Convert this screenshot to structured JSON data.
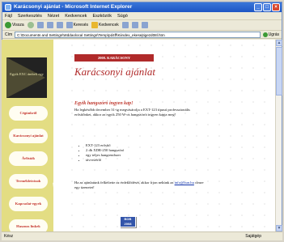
{
  "window": {
    "title": "Karácsonyi ajánlat - Microsoft Internet Explorer",
    "minimize": "_",
    "maximize": "□",
    "close": "×"
  },
  "menu": [
    "Fájl",
    "Szerkesztés",
    "Nézet",
    "Kedvencek",
    "Eszközök",
    "Súgó"
  ],
  "toolbar": {
    "back": "Vissza",
    "search": "Keresés",
    "favorites": "Kedvencek"
  },
  "address": {
    "label": "Cím",
    "value": "C:\\Documents and Settings\\Wddaolocal Settings\\Temp\\pd4ff\\Kiindex_ekesejtigezd08l.htm",
    "go": "Ugrás"
  },
  "status": {
    "left": "Kész",
    "zone": "Sajátgép"
  },
  "page": {
    "logo_text": "Egyik EXC ámbeli egy",
    "nav": [
      "Cégünkről",
      "Karácsonyi ajánlat",
      "Árlisták",
      "Termékleírások",
      "Kapcsolat-egyek",
      "Hasznos linkek"
    ],
    "redbar": "2008. KARÁCSONY",
    "headline": "Karácsonyi ajánlat",
    "subhead": "Egyik hangszóró ingyen kap!",
    "paragraph": "Ha legkésőbb december 31-ig megvásárolja a EXT-123 típusú professzionális erősítőnket, akkor az egyik 250 W-os hangszórót ingyen kapja meg!",
    "list": [
      "EXT-123 erősítő",
      "2 db XDR-250 hangszóró",
      "egy teljes hangrendszer",
      "távvezérlő"
    ],
    "contact_pre": "Ha az ajánlatunk felkeltette az érdeklődését, akkor írjon nekünk az",
    "contact_link": "info@hun.hu",
    "contact_post": "címre egy üzenetet!",
    "badge": "BOB 2008"
  }
}
